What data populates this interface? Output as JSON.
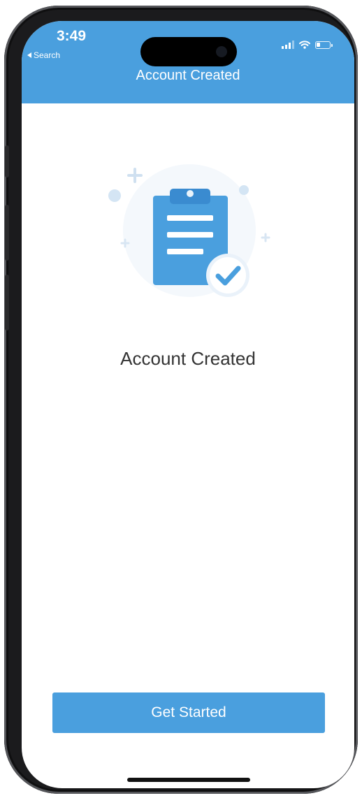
{
  "status_bar": {
    "time": "3:49",
    "back_label": "Search",
    "icons": [
      "cellular-signal-icon",
      "wifi-icon",
      "battery-icon"
    ],
    "battery_level": 0.3
  },
  "navbar": {
    "title": "Account Created",
    "color": "#4a9fde"
  },
  "illustration": {
    "icon": "clipboard-checkmark-icon",
    "primary_color": "#4a9fde",
    "accent_color": "#dbe9f6"
  },
  "content": {
    "heading": "Account Created"
  },
  "actions": {
    "get_started_label": "Get Started"
  }
}
